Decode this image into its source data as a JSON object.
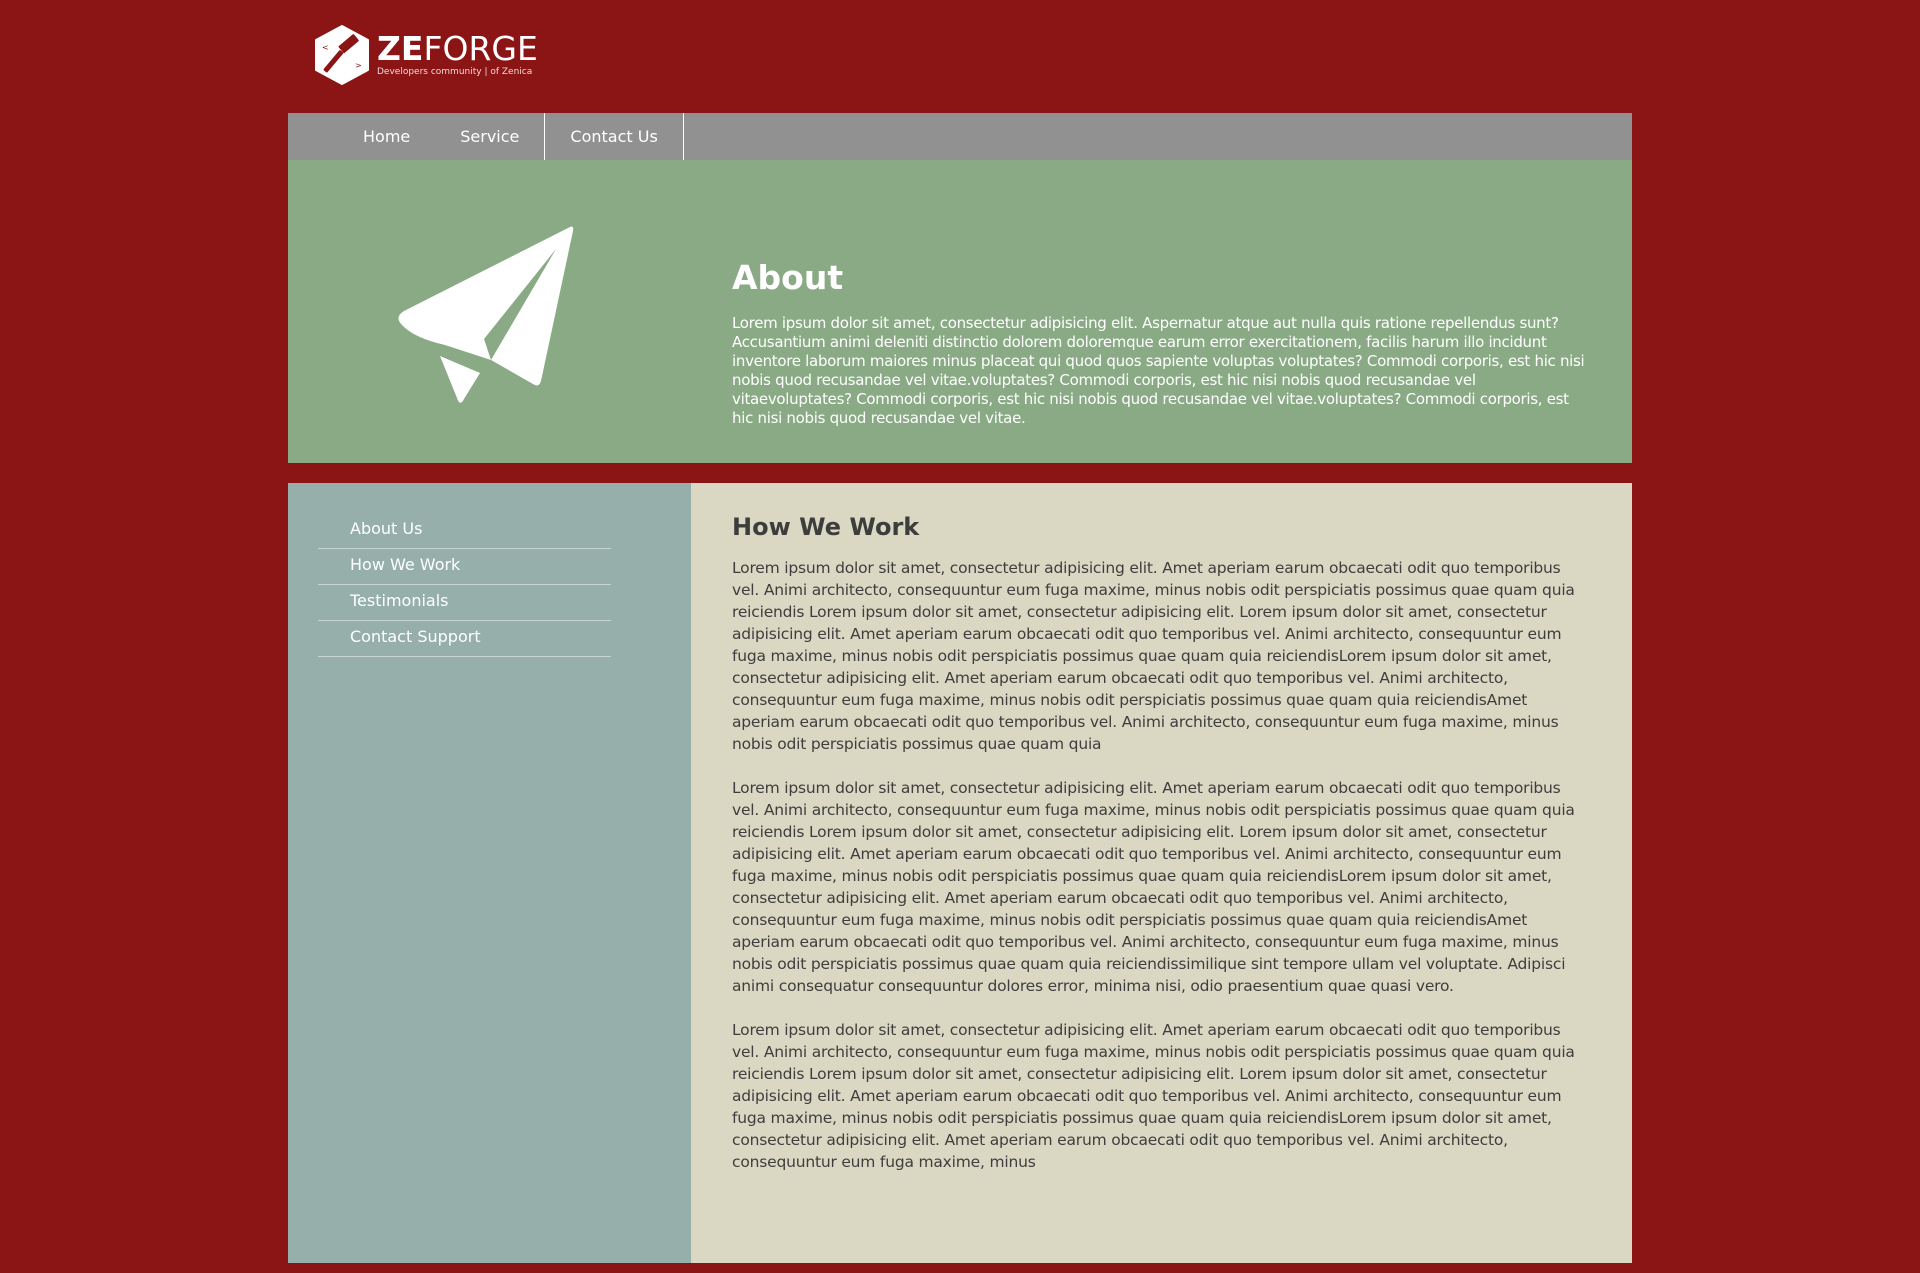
{
  "logo": {
    "brand_bold": "ZE",
    "brand_light": "FORGE",
    "tagline": "Developers community | of Zenica"
  },
  "nav": {
    "items": [
      "Home",
      "Service",
      "Contact Us"
    ]
  },
  "hero": {
    "icon": "paper-plane-icon",
    "title": "About",
    "text": "Lorem ipsum dolor sit amet, consectetur adipisicing elit. Aspernatur atque aut nulla quis ratione repellendus sunt? Accusantium animi deleniti distinctio dolorem doloremque earum error exercitationem, facilis harum illo incidunt inventore laborum maiores minus placeat qui quod quos sapiente voluptas voluptates? Commodi corporis, est hic nisi nobis quod recusandae vel vitae.voluptates? Commodi corporis, est hic nisi nobis quod recusandae vel vitaevoluptates? Commodi corporis, est hic nisi nobis quod recusandae vel vitae.voluptates? Commodi corporis, est hic nisi nobis quod recusandae vel vitae."
  },
  "sidebar": {
    "items": [
      "About Us",
      "How We Work",
      "Testimonials",
      "Contact Support"
    ]
  },
  "main": {
    "title": "How We Work",
    "paragraphs": [
      "Lorem ipsum dolor sit amet, consectetur adipisicing elit. Amet aperiam earum obcaecati odit quo temporibus vel. Animi architecto, consequuntur eum fuga maxime, minus nobis odit perspiciatis possimus quae quam quia reiciendis Lorem ipsum dolor sit amet, consectetur adipisicing elit. Lorem ipsum dolor sit amet, consectetur adipisicing elit. Amet aperiam earum obcaecati odit quo temporibus vel. Animi architecto, consequuntur eum fuga maxime, minus nobis odit perspiciatis possimus quae quam quia reiciendisLorem ipsum dolor sit amet, consectetur adipisicing elit. Amet aperiam earum obcaecati odit quo temporibus vel. Animi architecto, consequuntur eum fuga maxime, minus nobis odit perspiciatis possimus quae quam quia reiciendisAmet aperiam earum obcaecati odit quo temporibus vel. Animi architecto, consequuntur eum fuga maxime, minus nobis odit perspiciatis possimus quae quam quia",
      "Lorem ipsum dolor sit amet, consectetur adipisicing elit. Amet aperiam earum obcaecati odit quo temporibus vel. Animi architecto, consequuntur eum fuga maxime, minus nobis odit perspiciatis possimus quae quam quia reiciendis Lorem ipsum dolor sit amet, consectetur adipisicing elit. Lorem ipsum dolor sit amet, consectetur adipisicing elit. Amet aperiam earum obcaecati odit quo temporibus vel. Animi architecto, consequuntur eum fuga maxime, minus nobis odit perspiciatis possimus quae quam quia reiciendisLorem ipsum dolor sit amet, consectetur adipisicing elit. Amet aperiam earum obcaecati odit quo temporibus vel. Animi architecto, consequuntur eum fuga maxime, minus nobis odit perspiciatis possimus quae quam quia reiciendisAmet aperiam earum obcaecati odit quo temporibus vel. Animi architecto, consequuntur eum fuga maxime, minus nobis odit perspiciatis possimus quae quam quia reiciendissimilique sint tempore ullam vel voluptate. Adipisci animi consequatur consequuntur dolores error, minima nisi, odio praesentium quae quasi vero.",
      "Lorem ipsum dolor sit amet, consectetur adipisicing elit. Amet aperiam earum obcaecati odit quo temporibus vel. Animi architecto, consequuntur eum fuga maxime, minus nobis odit perspiciatis possimus quae quam quia reiciendis Lorem ipsum dolor sit amet, consectetur adipisicing elit. Lorem ipsum dolor sit amet, consectetur adipisicing elit. Amet aperiam earum obcaecati odit quo temporibus vel. Animi architecto, consequuntur eum fuga maxime, minus nobis odit perspiciatis possimus quae quam quia reiciendisLorem ipsum dolor sit amet, consectetur adipisicing elit. Amet aperiam earum obcaecati odit quo temporibus vel. Animi architecto, consequuntur eum fuga maxime, minus"
    ]
  },
  "colors": {
    "background": "#8b1515",
    "navbar": "#919191",
    "hero": "#89aa85",
    "sidebar": "#96afab",
    "main": "#dad7c2"
  }
}
